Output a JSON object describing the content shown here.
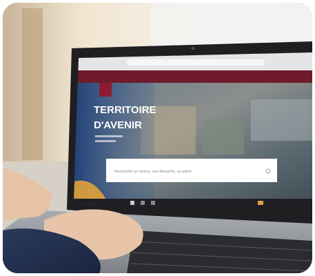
{
  "screen": {
    "heading_line1": "TERRITOIRE",
    "heading_line2": "D'AVENIR",
    "search_placeholder": "Rechercher un service, une démarche, un article"
  },
  "colors": {
    "browser_bar": "#e5e5e8",
    "accent_bar": "#6f1b2b",
    "logo": "#8d1c32"
  }
}
